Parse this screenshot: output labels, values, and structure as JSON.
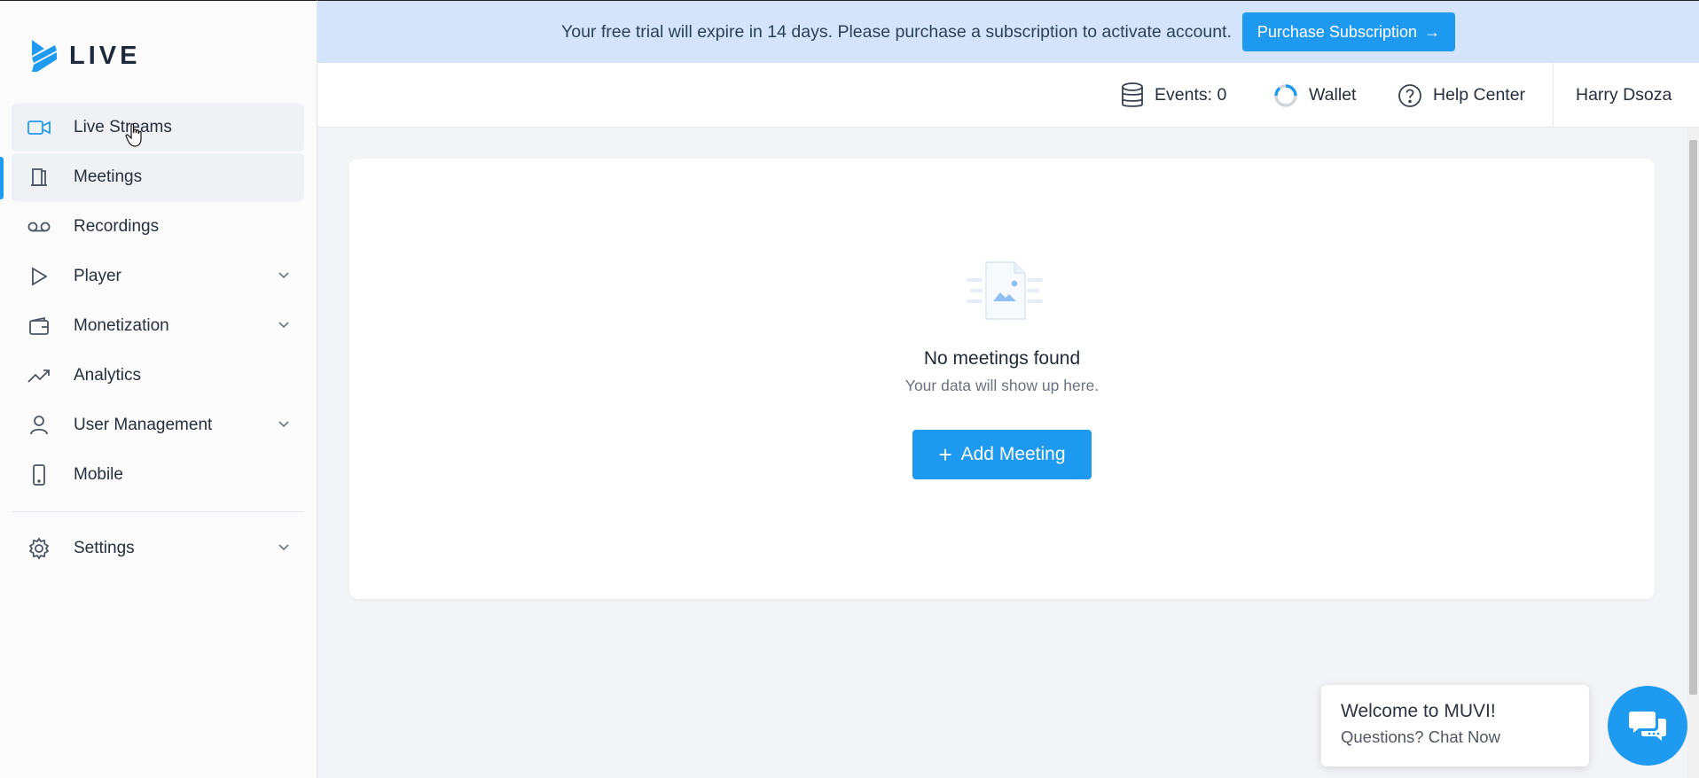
{
  "app": {
    "logo_text": "LIVE"
  },
  "sidebar": {
    "items": [
      {
        "label": "Live Streams",
        "icon": "video-camera-icon"
      },
      {
        "label": "Meetings",
        "icon": "door-icon"
      },
      {
        "label": "Recordings",
        "icon": "voicemail-icon"
      },
      {
        "label": "Player",
        "icon": "play-icon"
      },
      {
        "label": "Monetization",
        "icon": "wallet-icon"
      },
      {
        "label": "Analytics",
        "icon": "trend-icon"
      },
      {
        "label": "User Management",
        "icon": "user-icon"
      },
      {
        "label": "Mobile",
        "icon": "phone-icon"
      }
    ],
    "settings": {
      "label": "Settings",
      "icon": "gear-icon"
    }
  },
  "banner": {
    "text": "Your free trial will expire in 14 days. Please purchase a subscription to activate account.",
    "button_label": "Purchase Subscription",
    "button_arrow": "→"
  },
  "header": {
    "events_label": "Events: 0",
    "wallet_label": "Wallet",
    "help_label": "Help Center",
    "user_name": "Harry Dsoza"
  },
  "main": {
    "empty_title": "No meetings found",
    "empty_subtitle": "Your data will show up here.",
    "add_button_label": "Add Meeting",
    "add_button_icon": "+"
  },
  "chat": {
    "title": "Welcome to MUVI!",
    "subtitle": "Questions? Chat Now"
  },
  "colors": {
    "accent": "#1d9af0",
    "banner_bg": "#d4e5fb",
    "sidebar_bg": "#fbfbfc",
    "page_bg": "#f3f4f7"
  }
}
